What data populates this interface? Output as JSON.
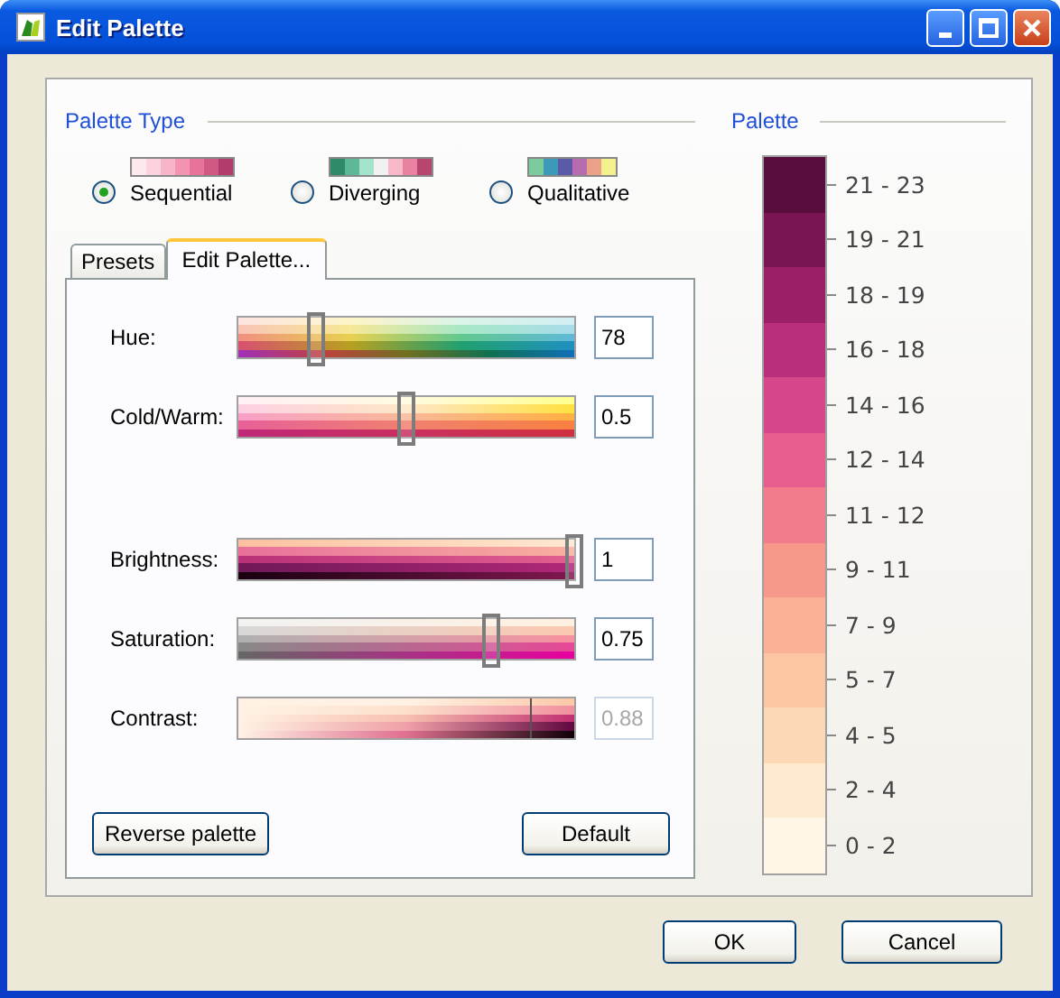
{
  "window": {
    "title": "Edit Palette"
  },
  "palette_type": {
    "heading": "Palette Type",
    "options": [
      {
        "label": "Sequential",
        "kind": "sequential",
        "selected": true
      },
      {
        "label": "Diverging",
        "kind": "diverging",
        "selected": false
      },
      {
        "label": "Qualitative",
        "kind": "qualitative",
        "selected": false
      }
    ]
  },
  "tabs": [
    {
      "label": "Presets",
      "selected": false
    },
    {
      "label": "Edit Palette...",
      "selected": true
    }
  ],
  "sliders": [
    {
      "label": "Hue:",
      "kind": "hue",
      "level": 0.23,
      "value": "78",
      "disabled": false
    },
    {
      "label": "Cold/Warm:",
      "kind": "coldwarm",
      "level": 0.5,
      "value": "0.5",
      "disabled": false
    },
    {
      "label": "Brightness:",
      "kind": "brightness",
      "level": 1,
      "value": "1",
      "disabled": false
    },
    {
      "label": "Saturation:",
      "kind": "saturation",
      "level": 0.75,
      "value": "0.75",
      "disabled": false
    },
    {
      "label": "Contrast:",
      "kind": "contrast",
      "level": 0.87,
      "value": "0.88",
      "disabled": true
    }
  ],
  "panel_buttons": [
    "Reverse palette",
    "Default"
  ],
  "palette": {
    "heading": "Palette",
    "items": [
      {
        "label": "21 - 23",
        "color": "#5a0c3e"
      },
      {
        "label": "19 - 21",
        "color": "#7a1452"
      },
      {
        "label": "18 - 19",
        "color": "#9a1f66"
      },
      {
        "label": "16 - 18",
        "color": "#b92f7c"
      },
      {
        "label": "14 - 16",
        "color": "#d6468b"
      },
      {
        "label": "12 - 14",
        "color": "#e65d8e"
      },
      {
        "label": "11 - 12",
        "color": "#f27c8b"
      },
      {
        "label": "9 - 11",
        "color": "#f6998b"
      },
      {
        "label": "7 - 9",
        "color": "#f9b296"
      },
      {
        "label": "5 - 7",
        "color": "#fcc6a3"
      },
      {
        "label": "4 - 5",
        "color": "#fdd8b7"
      },
      {
        "label": "2 - 4",
        "color": "#feeacf"
      },
      {
        "label": "0 - 2",
        "color": "#fff6e7"
      }
    ]
  },
  "dialog_buttons": [
    "OK",
    "Cancel"
  ]
}
